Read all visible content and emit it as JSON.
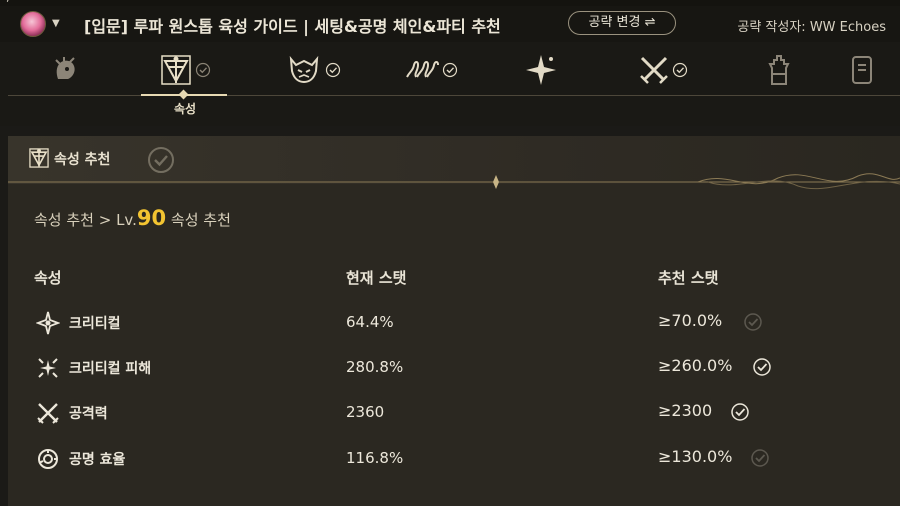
{
  "header": {
    "guide_title": "[입문] 루파 원스톱 육성 가이드 | 세팅&공명 체인&파티 추천",
    "change_button": "공략 변경 ⇌",
    "author_text": "공략 작성자: WW Echoes"
  },
  "tabs": [
    {
      "icon": "character-icon",
      "checked": false
    },
    {
      "icon": "attribute-icon",
      "checked": true,
      "active": true,
      "label": "속성"
    },
    {
      "icon": "echo-monster-icon",
      "checked": true
    },
    {
      "icon": "chain-icon",
      "checked": true
    },
    {
      "icon": "star-icon",
      "checked": false
    },
    {
      "icon": "swords-icon",
      "checked": true
    },
    {
      "icon": "tower-icon",
      "checked": false
    },
    {
      "icon": "document-icon",
      "checked": false
    }
  ],
  "active_tab_label": "속성",
  "panel": {
    "title": "속성 추천",
    "breadcrumb_prefix": "속성 추천 > Lv.",
    "level": "90",
    "breadcrumb_suffix": " 속성 추천",
    "columns": [
      "속성",
      "현재 스탯",
      "추천 스탯"
    ],
    "rows": [
      {
        "icon": "crit-icon",
        "name": "크리티컬",
        "current": "64.4%",
        "recommended": "≥70.0%",
        "met": false
      },
      {
        "icon": "crit-damage-icon",
        "name": "크리티컬 피해",
        "current": "280.8%",
        "recommended": "≥260.0%",
        "met": true
      },
      {
        "icon": "attack-icon",
        "name": "공격력",
        "current": "2360",
        "recommended": "≥2300",
        "met": true
      },
      {
        "icon": "energy-regen-icon",
        "name": "공명 효율",
        "current": "116.8%",
        "recommended": "≥130.0%",
        "met": false
      }
    ]
  },
  "colors": {
    "level_accent": "#f3c431",
    "background": "#1b1a17",
    "panel": "#2b2821"
  }
}
